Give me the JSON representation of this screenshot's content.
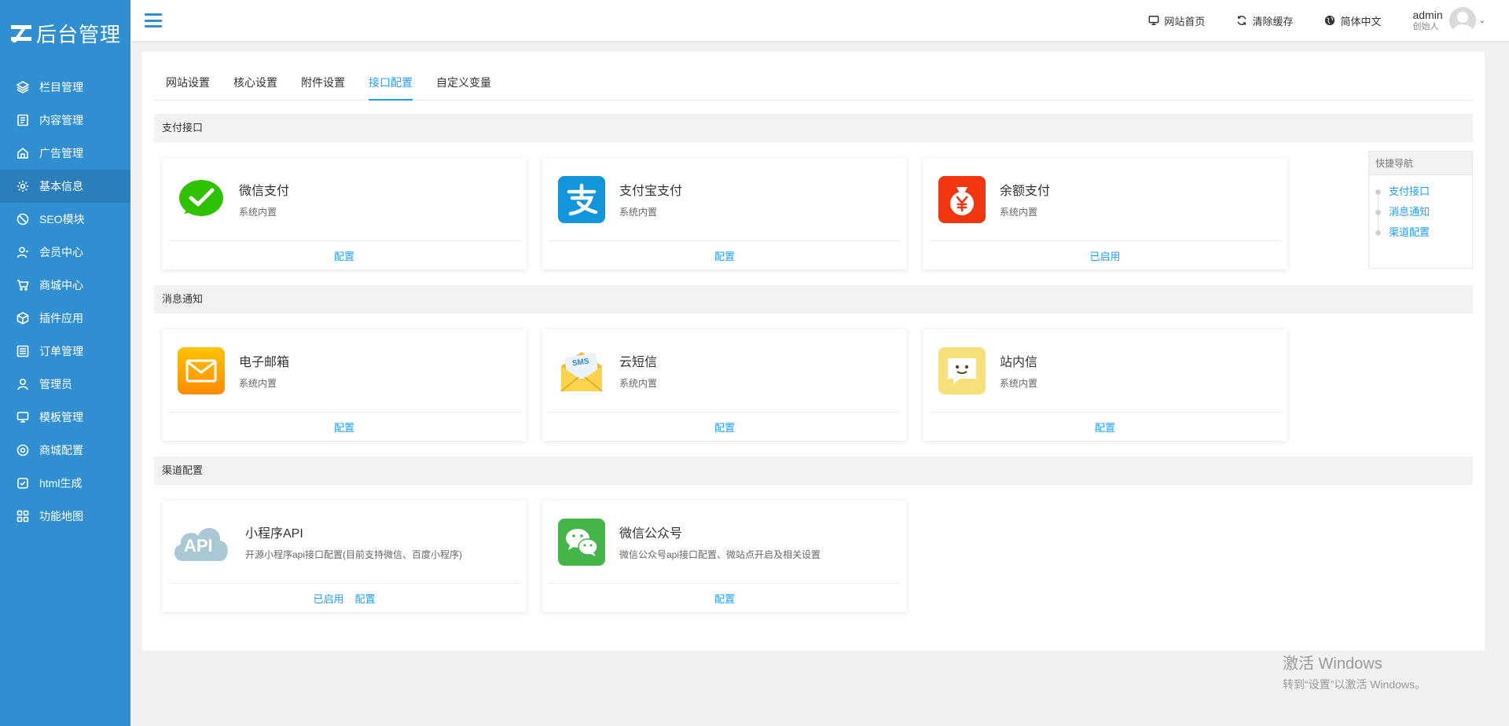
{
  "logo": {
    "text": "后台管理"
  },
  "sidebar": {
    "items": [
      {
        "label": "栏目管理",
        "icon": "layers-icon"
      },
      {
        "label": "内容管理",
        "icon": "document-icon"
      },
      {
        "label": "广告管理",
        "icon": "home-icon"
      },
      {
        "label": "基本信息",
        "icon": "gear-icon",
        "active": true
      },
      {
        "label": "SEO模块",
        "icon": "tag-icon"
      },
      {
        "label": "会员中心",
        "icon": "user-icon"
      },
      {
        "label": "商城中心",
        "icon": "cart-icon"
      },
      {
        "label": "插件应用",
        "icon": "cube-icon"
      },
      {
        "label": "订单管理",
        "icon": "list-icon"
      },
      {
        "label": "管理员",
        "icon": "admin-icon"
      },
      {
        "label": "模板管理",
        "icon": "monitor-icon"
      },
      {
        "label": "商城配置",
        "icon": "target-icon"
      },
      {
        "label": "html生成",
        "icon": "check-square-icon"
      },
      {
        "label": "功能地图",
        "icon": "grid-icon"
      }
    ]
  },
  "header": {
    "links": [
      {
        "label": "网站首页",
        "icon": "monitor-icon"
      },
      {
        "label": "清除缓存",
        "icon": "refresh-icon"
      },
      {
        "label": "简体中文",
        "icon": "globe-icon"
      }
    ],
    "user": {
      "name": "admin",
      "role": "创始人"
    }
  },
  "tabs": [
    {
      "label": "网站设置"
    },
    {
      "label": "核心设置"
    },
    {
      "label": "附件设置"
    },
    {
      "label": "接口配置",
      "active": true
    },
    {
      "label": "自定义变量"
    }
  ],
  "sections": {
    "pay": "支付接口",
    "notify": "消息通知",
    "channel": "渠道配置"
  },
  "cards": {
    "wechat_pay": {
      "title": "微信支付",
      "desc": "系统内置",
      "action": "配置"
    },
    "alipay": {
      "title": "支付宝支付",
      "desc": "系统内置",
      "action": "配置"
    },
    "balance": {
      "title": "余额支付",
      "desc": "系统内置",
      "action": "已启用"
    },
    "email": {
      "title": "电子邮箱",
      "desc": "系统内置",
      "action": "配置"
    },
    "sms": {
      "title": "云短信",
      "desc": "系统内置",
      "action": "配置",
      "badge": "SMS"
    },
    "inbox": {
      "title": "站内信",
      "desc": "系统内置",
      "action": "配置"
    },
    "miniapp": {
      "title": "小程序API",
      "desc": "开源小程序api接口配置(目前支持微信、百度小程序)",
      "action1": "已启用",
      "action2": "配置",
      "badge": "API"
    },
    "wechat_mp": {
      "title": "微信公众号",
      "desc": "微信公众号api接口配置、微站点开启及相关设置",
      "action": "配置"
    }
  },
  "quick_nav": {
    "title": "快捷导航",
    "items": [
      "支付接口",
      "消息通知",
      "渠道配置"
    ]
  },
  "os_watermark": {
    "line1": "激活 Windows",
    "line2": "转到“设置”以激活 Windows。"
  },
  "colors": {
    "sidebar": "#2f8fd0",
    "accent": "#1e9fff",
    "wechat": "#2dc100",
    "alipay": "#1296db",
    "balance": "#f0350f"
  }
}
